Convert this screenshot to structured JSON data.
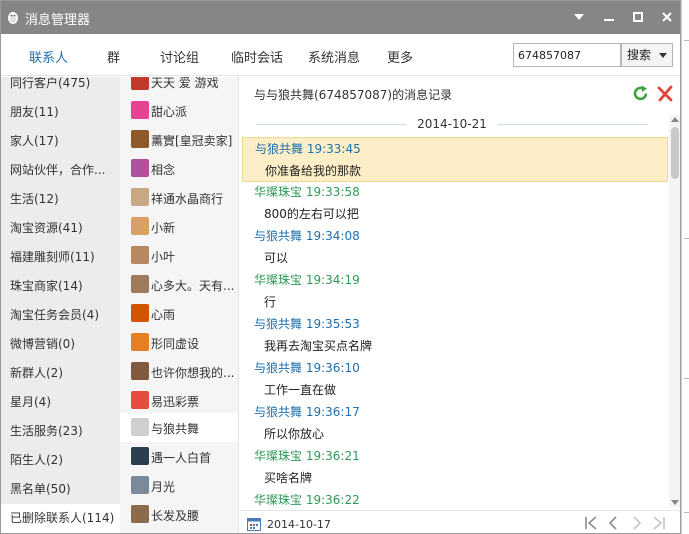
{
  "window": {
    "title": "消息管理器",
    "title_color": "#868686",
    "accent_color": "#1d6fb0"
  },
  "tabs": [
    {
      "label": "联系人",
      "active": true
    },
    {
      "label": "群",
      "active": false
    },
    {
      "label": "讨论组",
      "active": false
    },
    {
      "label": "临时会话",
      "active": false
    },
    {
      "label": "系统消息",
      "active": false
    },
    {
      "label": "更多",
      "active": false
    }
  ],
  "search": {
    "value": "674857087",
    "button_label": "搜索"
  },
  "groups": [
    {
      "label": "同行客户(475)"
    },
    {
      "label": "朋友(11)"
    },
    {
      "label": "家人(17)"
    },
    {
      "label": "网站伙伴，合作..."
    },
    {
      "label": "生活(12)"
    },
    {
      "label": "淘宝资源(41)"
    },
    {
      "label": "福建雕刻师(11)"
    },
    {
      "label": "珠宝商家(14)"
    },
    {
      "label": "淘宝任务会员(4)"
    },
    {
      "label": "微博营销(0)"
    },
    {
      "label": "新群人(2)"
    },
    {
      "label": "星月(4)"
    },
    {
      "label": "生活服务(23)"
    },
    {
      "label": "陌生人(2)"
    },
    {
      "label": "黑名单(50)"
    },
    {
      "label": "已删除联系人(114)",
      "selected": true
    }
  ],
  "contacts": [
    {
      "name": "天天 爱 游戏",
      "color": "#c0392b"
    },
    {
      "name": "甜心派",
      "color": "#e84393"
    },
    {
      "name": "薰實[皇冠卖家]",
      "color": "#8e5a2b"
    },
    {
      "name": "相念",
      "color": "#b0539c"
    },
    {
      "name": "祥通水晶商行",
      "color": "#c8a882"
    },
    {
      "name": "小新",
      "color": "#d9a066"
    },
    {
      "name": "小叶",
      "color": "#b7885f"
    },
    {
      "name": "心多大。天有...",
      "color": "#9c7a5b"
    },
    {
      "name": "心雨",
      "color": "#d35400"
    },
    {
      "name": "形同虚设",
      "color": "#e67e22"
    },
    {
      "name": "也许你想我的...",
      "color": "#7f5a3e"
    },
    {
      "name": "易迅彩票",
      "color": "#e74c3c"
    },
    {
      "name": "与狼共舞",
      "color": "#cfcfcf",
      "selected": true
    },
    {
      "name": "遇一人白首",
      "color": "#2c3e50"
    },
    {
      "name": "月光",
      "color": "#7a8a9a"
    },
    {
      "name": "长发及腰",
      "color": "#8b6b4b"
    }
  ],
  "chat": {
    "header": "与与狼共舞(674857087)的消息记录",
    "date_separator": "2014-10-21",
    "messages": [
      {
        "sender": "与狼共舞",
        "time": "19:33:45",
        "text": "你准备给我的那款",
        "type": "them",
        "highlighted": true
      },
      {
        "sender": "华璨珠宝",
        "time": "19:33:58",
        "text": "800的左右可以把",
        "type": "me"
      },
      {
        "sender": "与狼共舞",
        "time": "19:34:08",
        "text": "可以",
        "type": "them"
      },
      {
        "sender": "华璨珠宝",
        "time": "19:34:19",
        "text": "行",
        "type": "me"
      },
      {
        "sender": "与狼共舞",
        "time": "19:35:53",
        "text": "我再去淘宝买点名牌",
        "type": "them"
      },
      {
        "sender": "与狼共舞",
        "time": "19:36:10",
        "text": "工作一直在做",
        "type": "them"
      },
      {
        "sender": "与狼共舞",
        "time": "19:36:17",
        "text": "所以你放心",
        "type": "them"
      },
      {
        "sender": "华璨珠宝",
        "time": "19:36:21",
        "text": "买啥名牌",
        "type": "me"
      },
      {
        "sender": "华璨珠宝",
        "time": "19:36:22",
        "text": "",
        "type": "me"
      }
    ],
    "them_color": "#1d6fb0",
    "me_color": "#2e9a56",
    "highlight_color": "#fcefc7"
  },
  "footer": {
    "date": "2014-10-17"
  },
  "icons": {
    "app": "penguin-icon",
    "refresh": "refresh-icon",
    "delete": "delete-icon",
    "calendar": "calendar-icon"
  }
}
